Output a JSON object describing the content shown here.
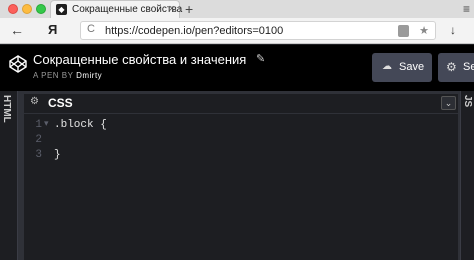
{
  "browser": {
    "tab": {
      "title": "Сокращенные свойства",
      "close": "×"
    },
    "new_tab": "+",
    "menu": "≡",
    "back": "←",
    "yandex": "Я",
    "reload": "C",
    "url": "https://codepen.io/pen?editors=0100",
    "star": "★",
    "download": "↓"
  },
  "codepen": {
    "title": "Сокращенные свойства и значения",
    "edit_icon": "✎",
    "byline_prefix": "A PEN BY",
    "author": "Dmirty",
    "save_label": "Save",
    "settings_label": "Se"
  },
  "editor": {
    "left_tab": "HTML",
    "right_tab": "JS",
    "panel_name": "CSS",
    "collapse": "⌄",
    "lines": [
      {
        "num": "1",
        "fold": "▾",
        "text": ".block {"
      },
      {
        "num": "2",
        "fold": "",
        "text": ""
      },
      {
        "num": "3",
        "fold": "",
        "text": "}"
      }
    ]
  }
}
